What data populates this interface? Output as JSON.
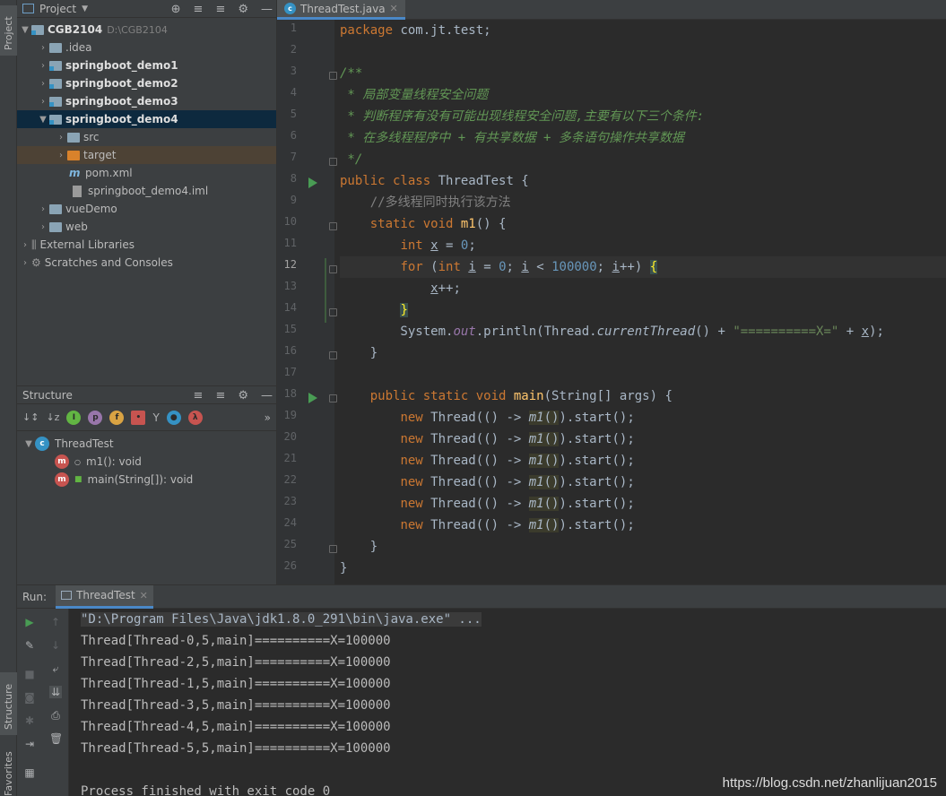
{
  "sidebar": {
    "project_tab": "Project",
    "structure_tab": "Structure",
    "favorites_tab": "Favorites"
  },
  "project": {
    "header": "Project",
    "tree": [
      {
        "label": "CGB2104",
        "path": "D:\\CGB2104",
        "bold": true
      },
      {
        "label": ".idea"
      },
      {
        "label": "springboot_demo1",
        "bold": true
      },
      {
        "label": "springboot_demo2",
        "bold": true
      },
      {
        "label": "springboot_demo3",
        "bold": true
      },
      {
        "label": "springboot_demo4",
        "bold": true
      },
      {
        "label": "src"
      },
      {
        "label": "target"
      },
      {
        "label": "pom.xml"
      },
      {
        "label": "springboot_demo4.iml"
      },
      {
        "label": "vueDemo"
      },
      {
        "label": "web"
      },
      {
        "label": "External Libraries"
      },
      {
        "label": "Scratches and Consoles"
      }
    ]
  },
  "structure": {
    "header": "Structure",
    "class_name": "ThreadTest",
    "members": [
      "m1(): void",
      "main(String[]): void"
    ]
  },
  "editor": {
    "tab": "ThreadTest.java",
    "current_line": 12,
    "line_count": 26
  },
  "run": {
    "label": "Run:",
    "tab": "ThreadTest",
    "output": [
      "\"D:\\Program Files\\Java\\jdk1.8.0_291\\bin\\java.exe\" ...",
      "Thread[Thread-0,5,main]==========X=100000",
      "Thread[Thread-2,5,main]==========X=100000",
      "Thread[Thread-1,5,main]==========X=100000",
      "Thread[Thread-3,5,main]==========X=100000",
      "Thread[Thread-4,5,main]==========X=100000",
      "Thread[Thread-5,5,main]==========X=100000",
      "",
      "Process finished with exit code 0"
    ]
  },
  "watermark": "https://blog.csdn.net/zhanlijuan2015"
}
